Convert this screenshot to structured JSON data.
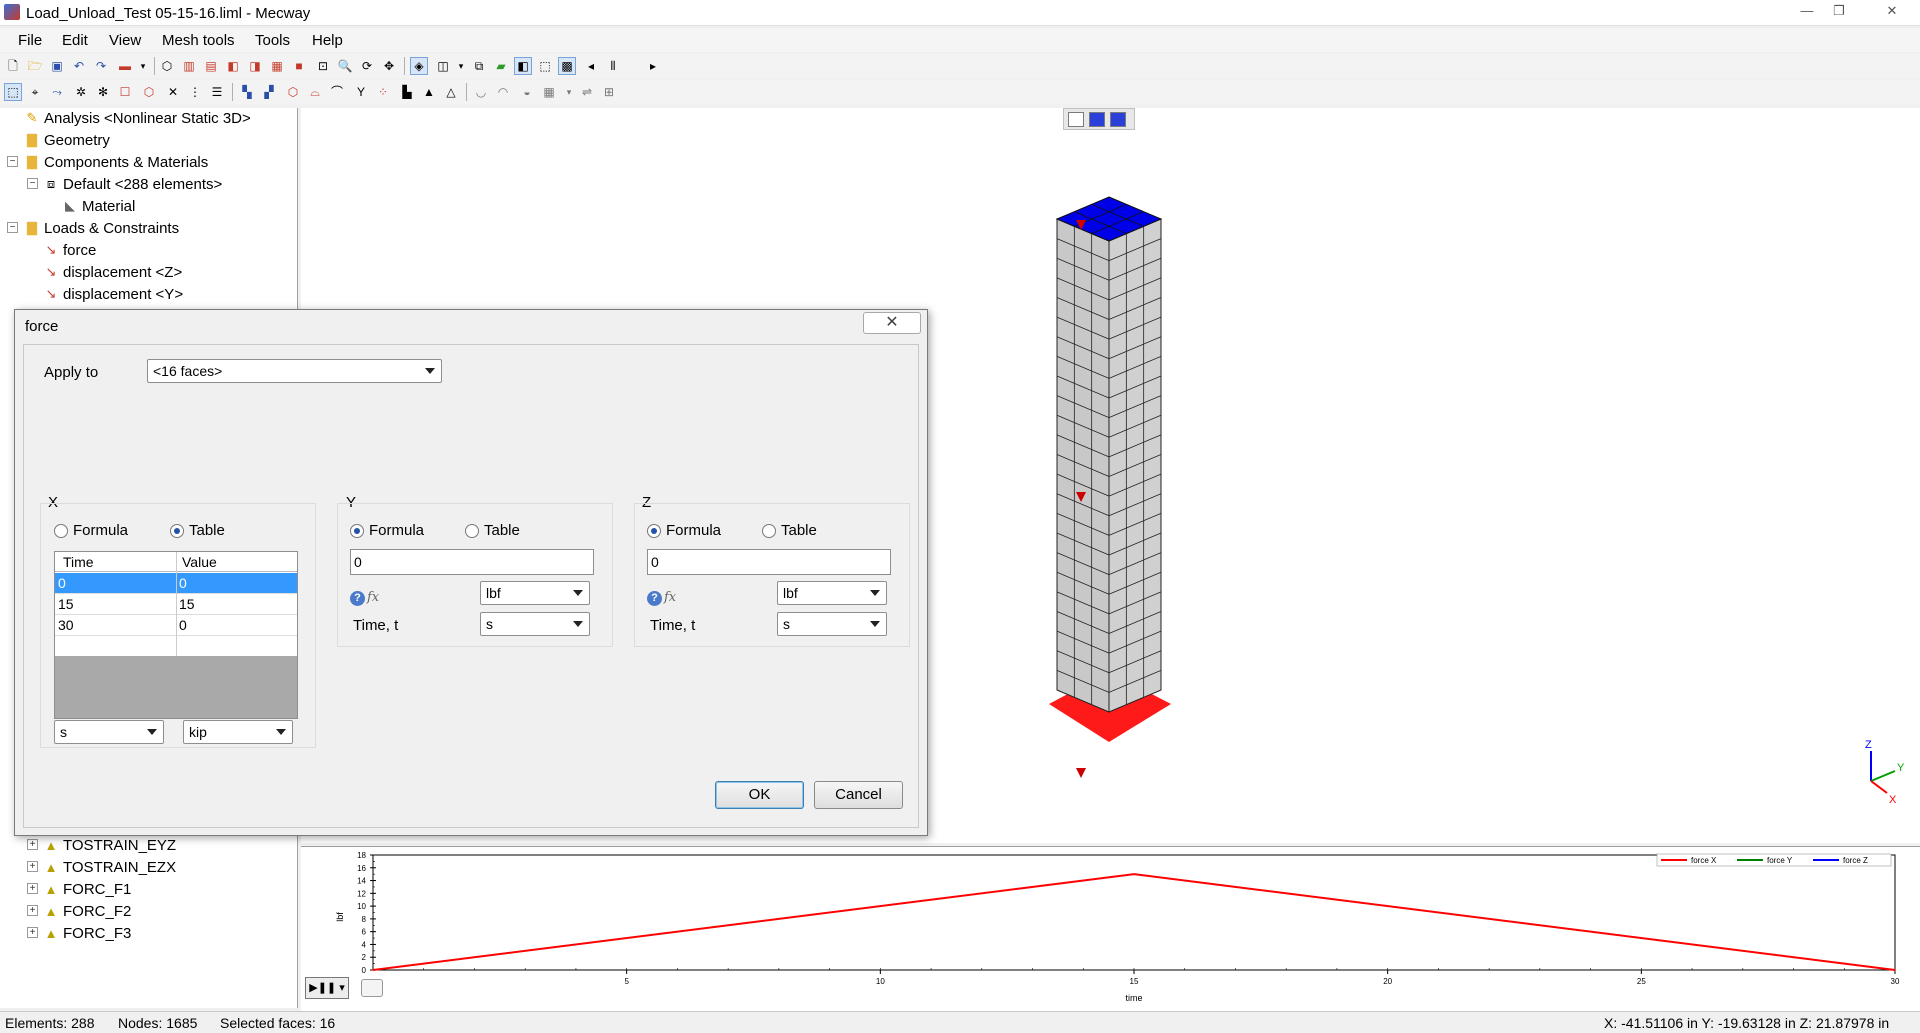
{
  "window": {
    "title": "Load_Unload_Test 05-15-16.liml - Mecway",
    "minimize": "—",
    "restore": "❐",
    "close": "✕"
  },
  "menu": [
    "File",
    "Edit",
    "View",
    "Mesh tools",
    "Tools",
    "Help"
  ],
  "tree": {
    "analysis": "Analysis <Nonlinear Static 3D>",
    "geometry": "Geometry",
    "components": "Components & Materials",
    "default": "Default <288 elements>",
    "material": "Material",
    "loads": "Loads & Constraints",
    "force": "force",
    "displacement_z": "displacement <Z>",
    "displacement_y": "displacement <Y>",
    "tostrain_eyz": "TOSTRAIN_EYZ",
    "tostrain_ezx": "TOSTRAIN_EZX",
    "forc_f1": "FORC_F1",
    "forc_f2": "FORC_F2",
    "forc_f3": "FORC_F3"
  },
  "dialog": {
    "title": "force",
    "close": "✕",
    "apply_to_label": "Apply to",
    "apply_to_value": "<16 faces>",
    "x": {
      "label": "X",
      "formula": "Formula",
      "table": "Table",
      "selected": "table",
      "columns": [
        "Time",
        "Value"
      ],
      "rows": [
        [
          "0",
          "0"
        ],
        [
          "15",
          "15"
        ],
        [
          "30",
          "0"
        ]
      ],
      "time_unit": "s",
      "value_unit": "kip"
    },
    "y": {
      "label": "Y",
      "formula": "Formula",
      "table": "Table",
      "selected": "formula",
      "value": "0",
      "unit": "lbf",
      "time_label": "Time, t",
      "time_unit": "s",
      "help": "?",
      "fx": "fx"
    },
    "z": {
      "label": "Z",
      "formula": "Formula",
      "table": "Table",
      "selected": "formula",
      "value": "0",
      "unit": "lbf",
      "time_label": "Time, t",
      "time_unit": "s",
      "help": "?",
      "fx": "fx"
    },
    "ok": "OK",
    "cancel": "Cancel"
  },
  "graph": {
    "legend": [
      "force X",
      "force Y",
      "force Z"
    ],
    "legend_colors": [
      "#ff0000",
      "#008000",
      "#0000ff"
    ],
    "xlabel": "time",
    "ylabel": "lbf",
    "x_ticks": [
      "5",
      "10",
      "15",
      "20",
      "25",
      "30"
    ],
    "y_ticks": [
      "0",
      "2",
      "4",
      "6",
      "8",
      "10",
      "12",
      "14",
      "16",
      "18"
    ]
  },
  "chart_data": {
    "type": "line",
    "xlabel": "time",
    "ylabel": "lbf",
    "xlim": [
      0,
      30
    ],
    "ylim": [
      0,
      18
    ],
    "series": [
      {
        "name": "force X",
        "color": "#ff0000",
        "x": [
          0,
          15,
          30
        ],
        "y": [
          0,
          15,
          0
        ]
      },
      {
        "name": "force Y",
        "color": "#008000",
        "x": [],
        "y": []
      },
      {
        "name": "force Z",
        "color": "#0000ff",
        "x": [],
        "y": []
      }
    ]
  },
  "axes": {
    "x": "X",
    "y": "Y",
    "z": "Z"
  },
  "status": {
    "elements": "Elements: 288",
    "nodes": "Nodes: 1685",
    "selected": "Selected faces: 16",
    "coords": "X: -41.51106 in Y: -19.63128 in Z: 21.87978 in"
  }
}
